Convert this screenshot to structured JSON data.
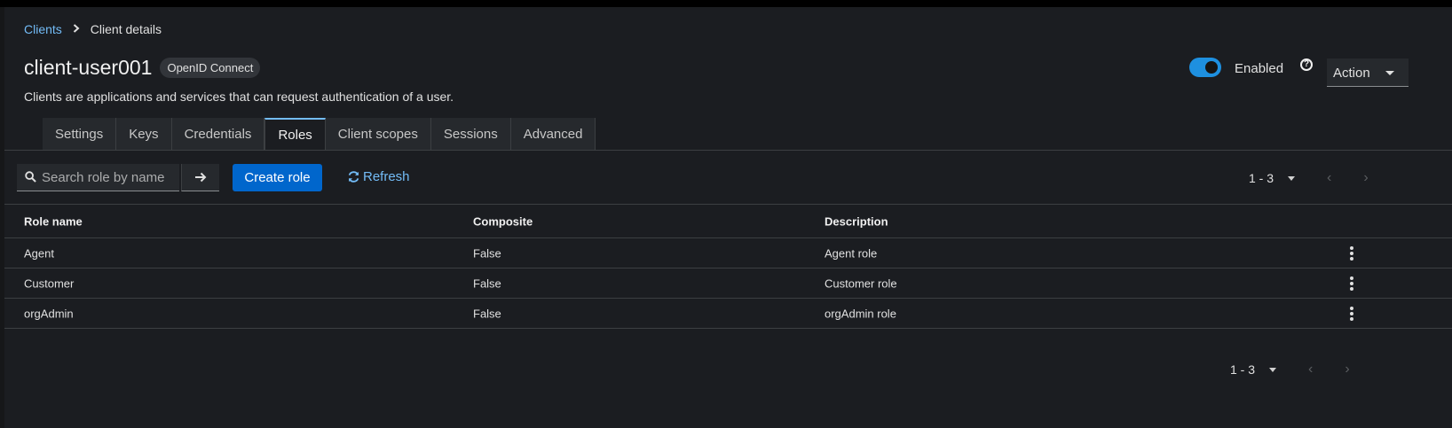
{
  "breadcrumb": {
    "parent": "Clients",
    "current": "Client details"
  },
  "header": {
    "title": "client-user001",
    "badge": "OpenID Connect",
    "subtitle": "Clients are applications and services that can request authentication of a user.",
    "enabled_label": "Enabled",
    "enabled": true,
    "help_icon": "?",
    "action_label": "Action"
  },
  "tabs": [
    {
      "label": "Settings"
    },
    {
      "label": "Keys"
    },
    {
      "label": "Credentials"
    },
    {
      "label": "Roles",
      "active": true
    },
    {
      "label": "Client scopes"
    },
    {
      "label": "Sessions"
    },
    {
      "label": "Advanced"
    }
  ],
  "toolbar": {
    "search_placeholder": "Search role by name",
    "create_label": "Create role",
    "refresh_label": "Refresh"
  },
  "pagination": {
    "range_top": "1 - 3",
    "range_bottom": "1 - 3"
  },
  "table": {
    "columns": [
      "Role name",
      "Composite",
      "Description"
    ],
    "rows": [
      {
        "name": "Agent",
        "composite": "False",
        "description": "Agent role"
      },
      {
        "name": "Customer",
        "composite": "False",
        "description": "Customer role"
      },
      {
        "name": "orgAdmin",
        "composite": "False",
        "description": "orgAdmin role"
      }
    ]
  },
  "colors": {
    "accent": "#73bcf7",
    "primary": "#0066cc",
    "toggle": "#1e90e0",
    "background": "#1b1d21"
  }
}
